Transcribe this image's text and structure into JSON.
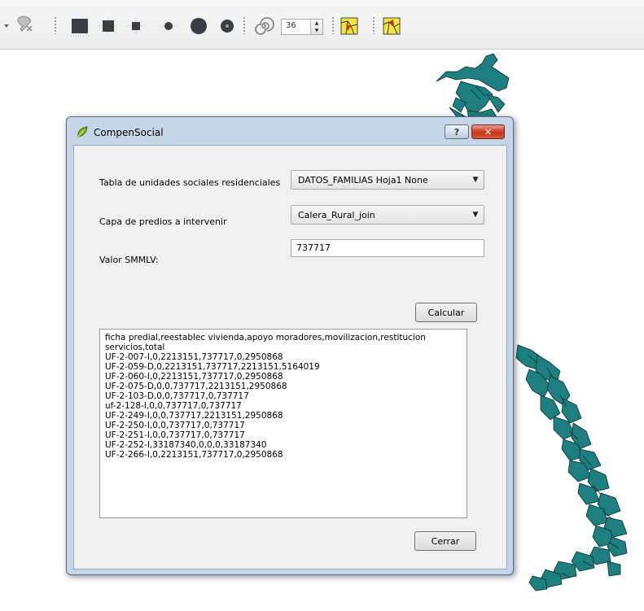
{
  "toolbar": {
    "icons": [
      "dropdown-arrow-icon",
      "node-tool-icon",
      "square-symbol-large-icon",
      "square-symbol-medium-icon",
      "square-symbol-small-icon",
      "circle-symbol-small-icon",
      "circle-symbol-large-icon",
      "circle-symbol-medium-icon",
      "spiral-icon",
      "polygon-tool-icon",
      "polygon-tool-icon-2"
    ],
    "spin_value": "36"
  },
  "dialog": {
    "title": "CompenSocial",
    "help_label": "?",
    "close_label": "✕",
    "fields": {
      "tabla_label": "Tabla de unidades sociales residenciales",
      "tabla_value": "DATOS_FAMILIAS Hoja1 None",
      "capa_label": "Capa de predios a intervenir",
      "capa_value": "Calera_Rural_join",
      "smmlv_label": "Valor SMMLV:",
      "smmlv_value": "737717"
    },
    "calcular_label": "Calcular",
    "cerrar_label": "Cerrar",
    "output_lines": [
      "ficha predial,reestablec vivienda,apoyo moradores,movilizacion,restitucion",
      "servicios,total",
      "UF-2-007-I,0,2213151,737717,0,2950868",
      "UF-2-059-D,0,2213151,737717,2213151,5164019",
      "UF-2-060-I,0,2213151,737717,0,2950868",
      "UF-2-075-D,0,0,737717,2213151,2950868",
      "UF-2-103-D,0,0,737717,0,737717",
      "uf-2-128-I,0,0,737717,0,737717",
      "UF-2-249-I,0,0,737717,2213151,2950868",
      "UF-2-250-I,0,0,737717,0,737717",
      "UF-2-251-I,0,0,737717,0,737717",
      "UF-2-252-I,33187340,0,0,0,33187340",
      "UF-2-266-I,0,2213151,737717,0,2950868"
    ]
  },
  "colors": {
    "map_fill": "#1e7f80",
    "map_stroke": "#0b2e2e",
    "dialog_frame": "#c6d5e7",
    "close_red": "#c4331a"
  }
}
